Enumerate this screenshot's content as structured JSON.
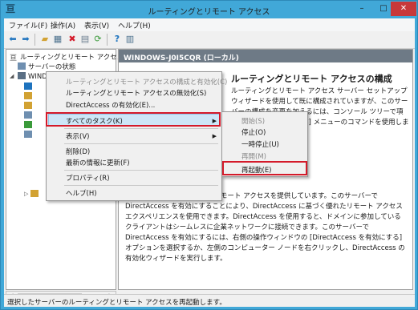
{
  "window": {
    "title": "ルーティングとリモート アクセス",
    "minimize": "–",
    "maximize": "□",
    "close": "✕"
  },
  "menubar": {
    "items": [
      "ファイル(F)",
      "操作(A)",
      "表示(V)",
      "ヘルプ(H)"
    ]
  },
  "toolbar": {
    "icons": [
      "back-arrow-icon",
      "forward-arrow-icon",
      "up-folder-icon",
      "console-tree-icon",
      "delete-icon",
      "properties-icon",
      "refresh-icon",
      "help-icon",
      "action-pane-icon"
    ]
  },
  "tree": {
    "root": "ルーティングとリモート アクセス",
    "server_status": "サーバーの状態",
    "server": "WINDOWS-J0I5CQR (ローカル)"
  },
  "right_pane": {
    "header": "WINDOWS-J0I5CQR (ローカル)",
    "heading": "ルーティングとリモート アクセスの構成",
    "p1": "ルーティングとリモート アクセス サーバー セットアップ ウィザードを使用して既に構成されていますが、このサーバーの構成を変更を加えるには、コンソール ツリーで項目を選択してから、[操作] メニューのコマンドを使用します。",
    "p2": "このサーバーは、ポイントにリモート アクセスを提供しています。このサーバーで DirectAccess を有効にすることにより、DirectAccess に基づく優れたリモート アクセス エクスペリエンスを使用できます。DirectAccess を使用すると、ドメインに参加しているクライアントはシームレスに企業ネットワークに接続できます。このサーバーで DirectAccess を有効にするには、右側の操作ウィンドウの [DirectAccess を有効にする] オプションを選択するか、左側のコンピューター ノードを右クリックし、DirectAccess の有効化ウィザードを実行します。"
  },
  "context_menu": {
    "items": [
      {
        "label": "ルーティングとリモート アクセスの構成と有効化(C)",
        "disabled": true
      },
      {
        "label": "ルーティングとリモート アクセスの無効化(S)",
        "disabled": false
      },
      {
        "label": "DirectAccess の有効化(E)...",
        "disabled": false
      },
      {
        "label": "すべてのタスク(K)",
        "disabled": false,
        "submenu": true,
        "highlighted": true
      },
      {
        "label": "表示(V)",
        "disabled": false,
        "submenu": true
      },
      {
        "label": "削除(D)",
        "disabled": false
      },
      {
        "label": "最新の情報に更新(F)",
        "disabled": false
      },
      {
        "label": "プロパティ(R)",
        "disabled": false
      },
      {
        "label": "ヘルプ(H)",
        "disabled": false
      }
    ]
  },
  "submenu": {
    "items": [
      {
        "label": "開始(S)",
        "disabled": true
      },
      {
        "label": "停止(O)",
        "disabled": false
      },
      {
        "label": "一時停止(U)",
        "disabled": false
      },
      {
        "label": "再開(M)",
        "disabled": true
      },
      {
        "label": "再起動(E)",
        "disabled": false,
        "highlighted": true
      }
    ]
  },
  "statusbar": {
    "text": "選択したサーバーのルーティングとリモート アクセスを再起動します。"
  },
  "colors": {
    "title_bar": "#41a8d8",
    "close_button": "#c7383a",
    "highlight_red": "#d41a2a",
    "pane_header": "#6e7a86",
    "menu_highlight": "#cde6f7"
  }
}
